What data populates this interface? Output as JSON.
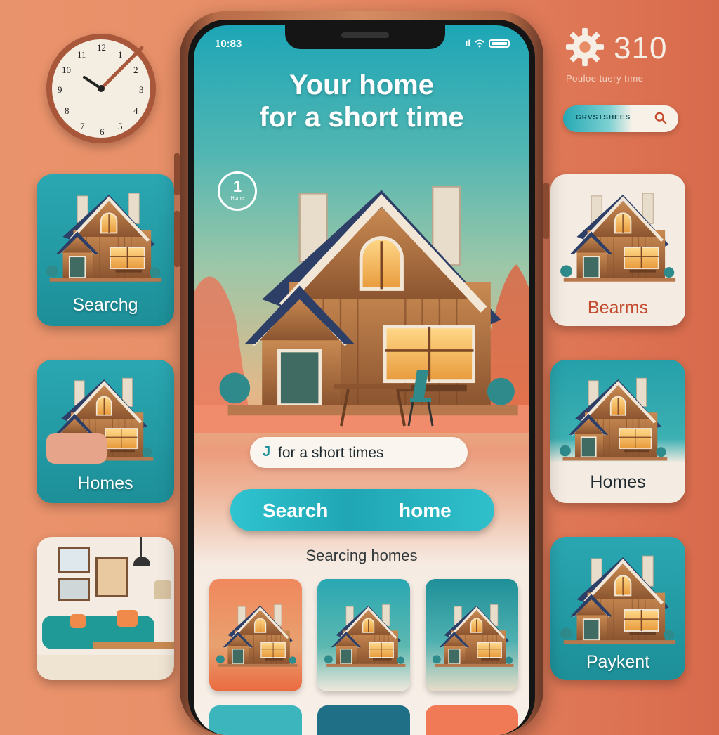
{
  "status_bar": {
    "time": "10:83",
    "signal": "ıl"
  },
  "hero": {
    "title_line1": "Your home",
    "title_line2": "for a short time",
    "step_number": "1",
    "step_caption": "Home"
  },
  "tag_pill": {
    "cursor": "J",
    "text": "for a short times"
  },
  "search_button": {
    "left_label": "Search",
    "right_label": "home"
  },
  "section_label": "Searcing homes",
  "top_right": {
    "number": "310",
    "caption": "Pouloe  tuery tıme",
    "mini_search_text": "GRVSTSHEES"
  },
  "left_cards": [
    {
      "label": "Searchg"
    },
    {
      "label": "Homes"
    },
    {
      "label": ""
    }
  ],
  "right_cards": [
    {
      "label": "Bearms"
    },
    {
      "label": "Homes"
    },
    {
      "label": "Paykent"
    }
  ],
  "colors": {
    "background": "#e88e66",
    "teal": "#1da6b6",
    "accent_red": "#c44a2e",
    "cream": "#f7f0e8"
  }
}
